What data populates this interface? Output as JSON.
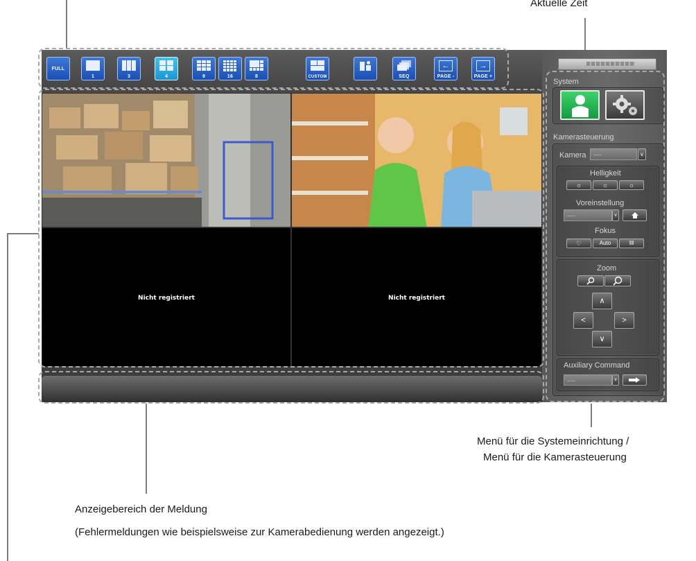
{
  "toolbar": {
    "buttons": [
      {
        "label": "FULL"
      },
      {
        "label": "1"
      },
      {
        "label": "3"
      },
      {
        "label": "4"
      },
      {
        "label": "9"
      },
      {
        "label": "16"
      },
      {
        "label": "8"
      },
      {
        "label": "CUSTOM"
      },
      {
        "label": ""
      },
      {
        "label": "SEQ"
      },
      {
        "label": "PAGE -"
      },
      {
        "label": "PAGE +"
      }
    ],
    "active_layout": "4"
  },
  "video": {
    "cells": [
      {
        "message": ""
      },
      {
        "message": ""
      },
      {
        "message": "Nicht registriert"
      },
      {
        "message": "Nicht registriert"
      }
    ]
  },
  "panel": {
    "system_title": "System",
    "camera_control_title": "Kamerasteuerung",
    "camera_label": "Kamera",
    "camera_value": "----",
    "brightness_label": "Helligkeit",
    "preset_label": "Voreinstellung",
    "preset_value": "----",
    "focus_label": "Fokus",
    "focus_auto": "Auto",
    "zoom_label": "Zoom",
    "aux_label": "Auxiliary Command",
    "aux_value": "----",
    "arrows": {
      "up": "∧",
      "left": "<",
      "right": ">",
      "down": "∨"
    }
  },
  "callouts": {
    "current_time": "Aktuelle Zeit",
    "menu_line1": "Menü für die Systemeinrichtung /",
    "menu_line2": "Menü für die Kamerasteuerung",
    "message_area": "Anzeigebereich der Meldung",
    "message_note": "(Fehlermeldungen wie beispielsweise zur Kamerabedienung werden angezeigt.)"
  },
  "colors": {
    "button_blue": "#1a4fb3",
    "button_active": "#1a96d6",
    "system_active": "#1fa84a"
  }
}
